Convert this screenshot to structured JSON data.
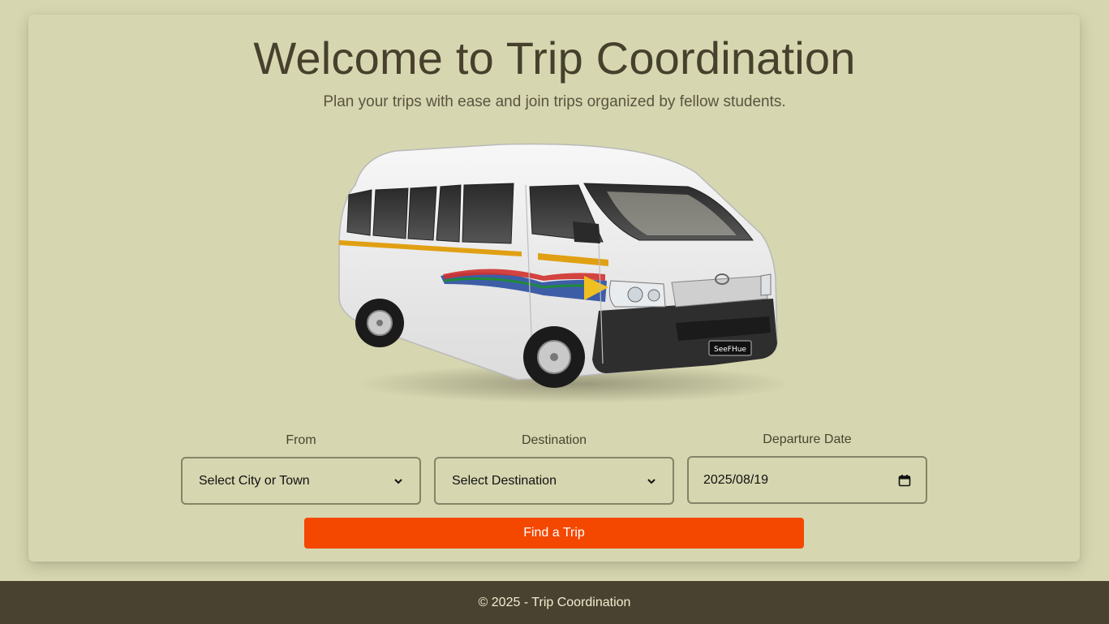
{
  "hero": {
    "title": "Welcome to Trip Coordination",
    "subtitle": "Plan your trips with ease and join trips organized by fellow students."
  },
  "vehicle_image": {
    "icon": "minibus-taxi-image",
    "plate_text": "SeeFHue"
  },
  "form": {
    "from": {
      "label": "From",
      "value": "Select City or Town"
    },
    "destination": {
      "label": "Destination",
      "value": "Select Destination"
    },
    "departure_date": {
      "label": "Departure Date",
      "value": "2025/08/19"
    },
    "submit_label": "Find a Trip"
  },
  "footer": {
    "text": "© 2025 - Trip Coordination"
  },
  "colors": {
    "background": "#d6d6b0",
    "accent": "#f44800",
    "footer_bg": "#4a4230",
    "text": "#46402c"
  }
}
